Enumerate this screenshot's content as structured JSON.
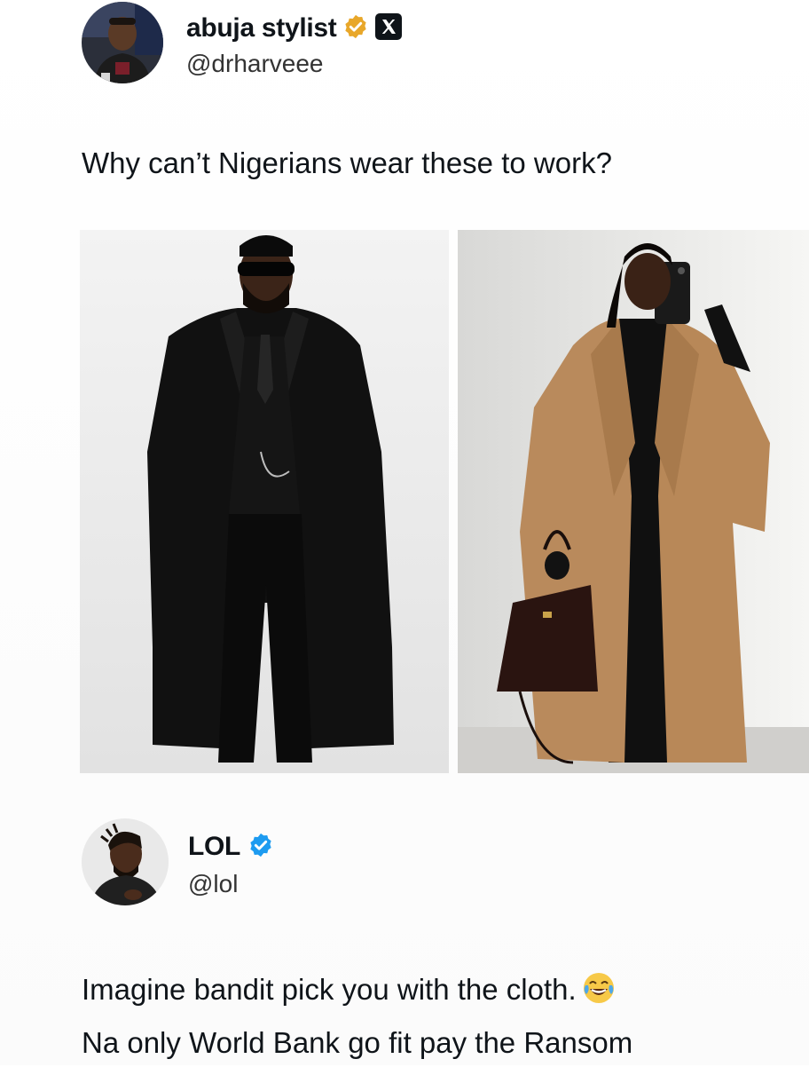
{
  "post": {
    "author": {
      "display_name": "abuja stylist",
      "handle": "@drharveee",
      "verified_badge": "gold-verified-badge-icon",
      "platform_icon": "x-logo-icon"
    },
    "text": "Why can’t Nigerians wear these to work?",
    "media": [
      {
        "description_icon": "man-black-overcoat-photo"
      },
      {
        "description_icon": "woman-camel-coat-photo"
      }
    ]
  },
  "reply": {
    "author": {
      "display_name": "LOL",
      "handle": "@lol",
      "verified_badge": "blue-verified-badge-icon"
    },
    "text_line1": "Imagine bandit pick you with the cloth.",
    "emoji": "tears-of-joy-emoji-icon",
    "text_line2": "Na only World Bank go fit pay the Ransom"
  },
  "colors": {
    "gold_badge": "#e8a72a",
    "blue_badge": "#1d9bf0",
    "text_primary": "#0f1419",
    "text_secondary": "#333333"
  }
}
